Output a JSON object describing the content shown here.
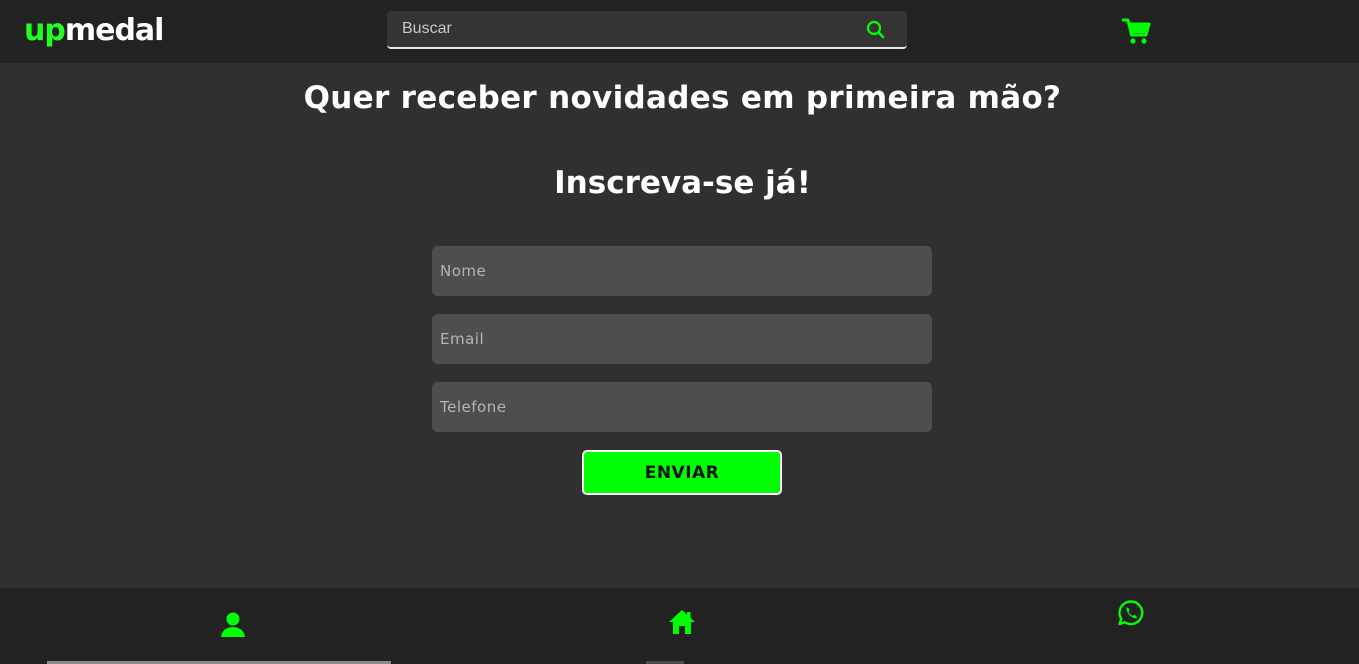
{
  "header": {
    "logo": {
      "part1": "up",
      "part2": "medal"
    },
    "search": {
      "placeholder": "Buscar",
      "value": ""
    },
    "icons": {
      "search": "search-icon",
      "cart": "cart-icon"
    }
  },
  "main": {
    "title": "Quer receber novidades em primeira mão?",
    "subtitle": "Inscreva-se já!",
    "form": {
      "name_placeholder": "Nome",
      "email_placeholder": "Email",
      "phone_placeholder": "Telefone",
      "submit_label": "ENVIAR"
    }
  },
  "footer": {
    "icons": [
      "user-icon",
      "home-icon",
      "whatsapp-icon"
    ]
  },
  "colors": {
    "accent": "#00ff00",
    "header_bg": "#222222",
    "page_bg": "#303030",
    "field_bg": "#4e4e4e"
  }
}
